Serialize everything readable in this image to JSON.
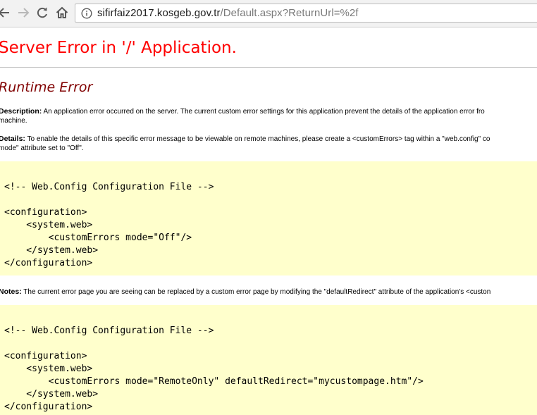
{
  "browser": {
    "back_icon": "back-arrow-icon",
    "forward_icon": "forward-arrow-icon",
    "reload_icon": "reload-icon",
    "home_icon": "home-icon",
    "info_icon": "info-icon",
    "url_host": "sifirfaiz2017.kosgeb.gov.tr",
    "url_path": "/Default.aspx?ReturnUrl=%2f"
  },
  "page": {
    "title": "Server Error in '/' Application.",
    "subtitle": "Runtime Error",
    "description_label": "Description:",
    "description_text": "An application error occurred on the server. The current custom error settings for this application prevent the details of the application error fro",
    "description_text_2": "machine.",
    "details_label": "Details:",
    "details_text": "To enable the details of this specific error message to be viewable on remote machines, please create a <customErrors> tag within a \"web.config\" co",
    "details_text_2": "mode\" attribute set to \"Off\".",
    "notes_label": "Notes:",
    "notes_text": "The current error page you are seeing can be replaced by a custom error page by modifying the \"defaultRedirect\" attribute of the application's <custon",
    "code_block_1": [
      "<!-- Web.Config Configuration File -->",
      "",
      "<configuration>",
      "    <system.web>",
      "        <customErrors mode=\"Off\"/>",
      "    </system.web>",
      "</configuration>"
    ],
    "code_block_2": [
      "<!-- Web.Config Configuration File -->",
      "",
      "<configuration>",
      "    <system.web>",
      "        <customErrors mode=\"RemoteOnly\" defaultRedirect=\"mycustompage.htm\"/>",
      "    </system.web>",
      "</configuration>"
    ]
  },
  "colors": {
    "title": "#ff0000",
    "subtitle": "#800000",
    "code_background": "#ffffcc"
  }
}
